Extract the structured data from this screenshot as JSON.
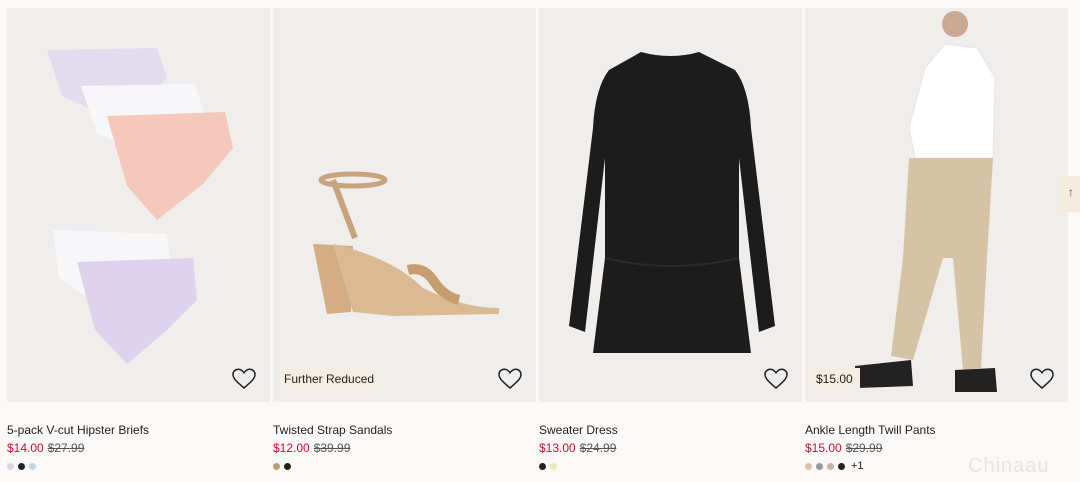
{
  "products": [
    {
      "title": "5-pack V-cut Hipster Briefs",
      "price": "$14.00",
      "old_price": "$27.99",
      "badge": "",
      "favorite_icon": "heart-outline-icon",
      "swatches": [
        "#d9d3e6",
        "#222222",
        "#c5d3ea"
      ],
      "more": ""
    },
    {
      "title": "Twisted Strap Sandals",
      "price": "$12.00",
      "old_price": "$39.99",
      "badge": "Further Reduced",
      "favorite_icon": "heart-outline-icon",
      "swatches": [
        "#b89b74",
        "#222222"
      ],
      "more": ""
    },
    {
      "title": "Sweater Dress",
      "price": "$13.00",
      "old_price": "$24.99",
      "badge": "",
      "favorite_icon": "heart-outline-icon",
      "swatches": [
        "#222222",
        "#f3e8b9"
      ],
      "more": ""
    },
    {
      "title": "Ankle Length Twill Pants",
      "price": "$15.00",
      "old_price": "$29.99",
      "badge": "$15.00",
      "favorite_icon": "heart-outline-icon",
      "swatches": [
        "#d5c5ad",
        "#9b9b9b",
        "#c9b3a8",
        "#222222"
      ],
      "more": "+1"
    }
  ],
  "scroll_top": {
    "icon": "arrow-up-icon",
    "glyph": "↑"
  },
  "watermark": "Chinaau"
}
